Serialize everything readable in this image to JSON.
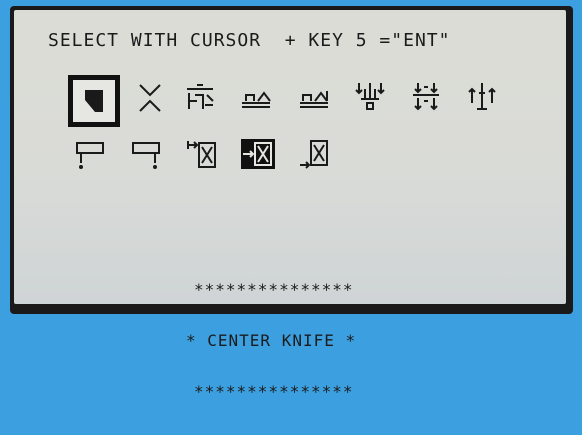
{
  "header": {
    "instruction": "SELECT WITH CURSOR  + KEY 5 =\"ENT\""
  },
  "icons_row1": [
    "knife-position-icon",
    "cut-symbol-icon",
    "clamp-knife-icon",
    "sheet-pressure-icon",
    "sheet-pressure-adjust-icon",
    "clamp-down-icon",
    "double-arrow-pressure-icon",
    "backgauge-up-arrows-icon"
  ],
  "icons_row2": [
    "table-left-icon",
    "table-right-icon",
    "stack-in-icon",
    "center-knife-icon",
    "stack-out-icon"
  ],
  "selected_icon": "knife-position-icon",
  "inverted_icon": "center-knife-icon",
  "footer": {
    "stars_top": "***************",
    "label": "* CENTER KNIFE *",
    "stars_bottom": "***************"
  }
}
